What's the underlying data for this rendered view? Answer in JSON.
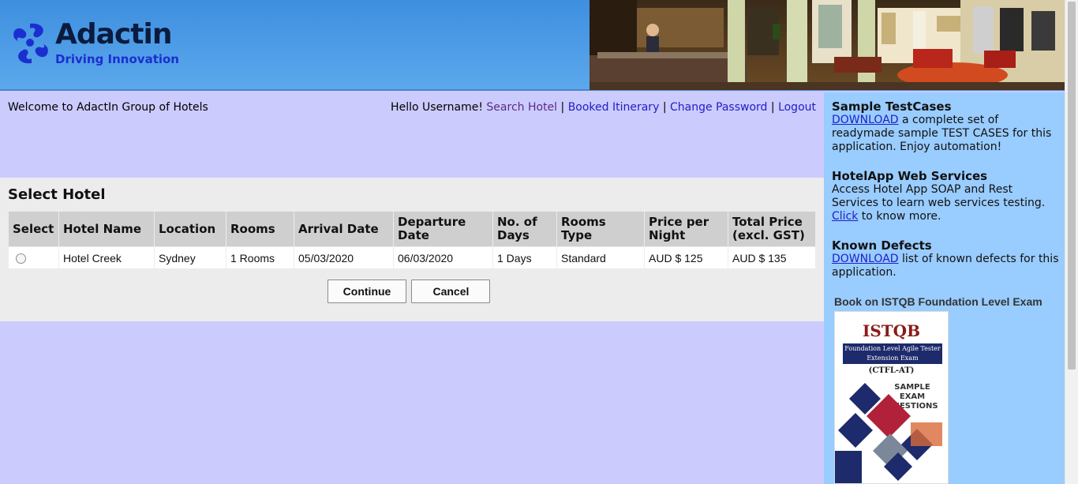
{
  "brand": {
    "name": "Adactin",
    "tagline": "Driving Innovation"
  },
  "header": {
    "welcome": "Welcome to AdactIn Group of Hotels",
    "greeting": "Hello Username!",
    "nav": [
      {
        "label": "Search Hotel"
      },
      {
        "label": "Booked Itinerary"
      },
      {
        "label": "Change Password"
      },
      {
        "label": "Logout"
      }
    ],
    "separator": "|"
  },
  "select_hotel": {
    "title": "Select Hotel",
    "columns": [
      "Select",
      "Hotel Name",
      "Location",
      "Rooms",
      "Arrival Date",
      "Departure Date",
      "No. of Days",
      "Rooms Type",
      "Price per Night",
      "Total Price (excl. GST)"
    ],
    "rows": [
      {
        "hotel_name": "Hotel Creek",
        "location": "Sydney",
        "rooms": "1 Rooms",
        "arrival_date": "05/03/2020",
        "departure_date": "06/03/2020",
        "no_of_days": "1 Days",
        "rooms_type": "Standard",
        "price_per_night": "AUD $ 125",
        "total_price": "AUD $ 135",
        "selected": false
      }
    ],
    "continue_label": "Continue",
    "cancel_label": "Cancel"
  },
  "sidebar": {
    "testcases": {
      "title": "Sample TestCases",
      "link": "DOWNLOAD",
      "text": " a complete set of readymade sample TEST CASES for this application. Enjoy automation!"
    },
    "webservices": {
      "title": "HotelApp Web Services",
      "text": "Access Hotel App SOAP and Rest Services to learn web services testing.",
      "link": "Click",
      "text_after": " to know more."
    },
    "defects": {
      "title": "Known Defects",
      "link": "DOWNLOAD",
      "text": " list of known defects for this application."
    },
    "book": {
      "title": "Book on ISTQB Foundation Level Exam",
      "cover_title": "ISTQB",
      "cover_subtitle": "Foundation Level Agile Tester Extension Exam",
      "cover_code": "(CTFL-AT)",
      "cover_tagline": "SAMPLE EXAM QUESTIONS"
    }
  },
  "colors": {
    "main_bg": "#cccbfe",
    "panel_bg": "#ececec",
    "sidebar_bg": "#99ccff",
    "link": "#1e20c8",
    "visited_link": "#5a2a86"
  }
}
